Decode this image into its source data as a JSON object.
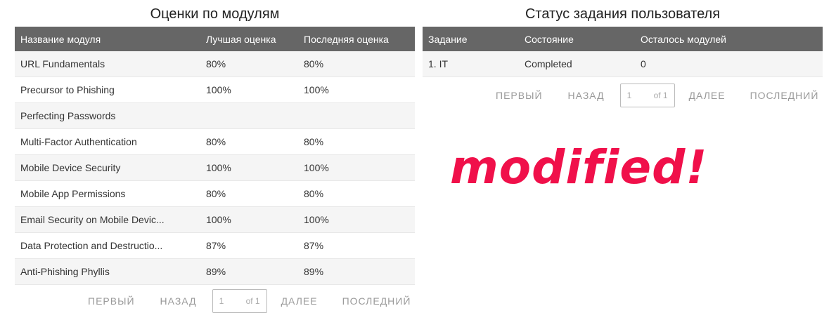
{
  "grades": {
    "title": "Оценки по модулям",
    "columns": [
      "Название модуля",
      "Лучшая оценка",
      "Последняя оценка"
    ],
    "rows": [
      {
        "name": "URL Fundamentals",
        "best": "80%",
        "last": "80%"
      },
      {
        "name": "Precursor to Phishing",
        "best": "100%",
        "last": "100%"
      },
      {
        "name": "Perfecting Passwords",
        "best": "",
        "last": ""
      },
      {
        "name": "Multi-Factor Authentication",
        "best": "80%",
        "last": "80%"
      },
      {
        "name": "Mobile Device Security",
        "best": "100%",
        "last": "100%"
      },
      {
        "name": "Mobile App Permissions",
        "best": "80%",
        "last": "80%"
      },
      {
        "name": "Email Security on Mobile Devic...",
        "best": "100%",
        "last": "100%"
      },
      {
        "name": "Data Protection and Destructio...",
        "best": "87%",
        "last": "87%"
      },
      {
        "name": "Anti-Phishing Phyllis",
        "best": "89%",
        "last": "89%"
      }
    ],
    "pager": {
      "first": "ПЕРВЫЙ",
      "prev": "НАЗАД",
      "page": "1",
      "of": "of 1",
      "next": "ДАЛЕЕ",
      "last": "ПОСЛЕДНИЙ"
    }
  },
  "status": {
    "title": "Статус задания пользователя",
    "columns": [
      "Задание",
      "Состояние",
      "Осталось модулей"
    ],
    "rows": [
      {
        "task": "1. IT",
        "state": "Completed",
        "remaining": "0"
      }
    ],
    "pager": {
      "first": "ПЕРВЫЙ",
      "prev": "НАЗАД",
      "page": "1",
      "of": "of 1",
      "next": "ДАЛЕЕ",
      "last": "ПОСЛЕДНИЙ"
    }
  },
  "overlay": {
    "stamp_text": "modified!",
    "stamp_color": "#f0104a"
  }
}
